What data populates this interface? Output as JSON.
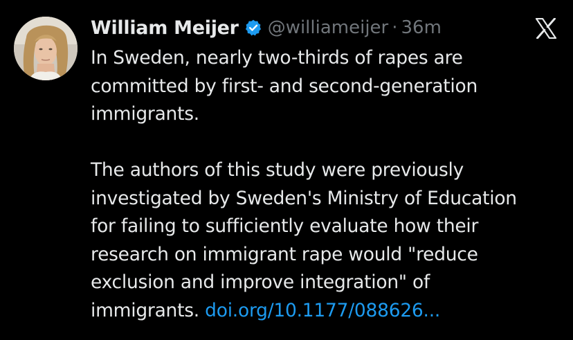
{
  "tweet": {
    "author_name": "William Meijer",
    "handle": "@williameijer",
    "separator": "·",
    "time": "36m",
    "paragraph1": [
      "In Sweden, nearly two-thirds of rapes are",
      "committed by first- and second-generation",
      "immigrants."
    ],
    "paragraph2": [
      "The authors of this study were previously",
      "investigated by Sweden's Ministry of Education",
      "for failing to sufficiently evaluate how their",
      "research on immigrant rape would \"reduce",
      "exclusion and improve integration\" of"
    ],
    "last_line_text": "immigrants. ",
    "link_text": "doi.org/10.1177/088626...",
    "icons": {
      "verified": "verified-badge-icon",
      "platform": "x-logo-icon"
    },
    "colors": {
      "background": "#000000",
      "text": "#e7e9ea",
      "muted": "#71767b",
      "link": "#1d9bf0",
      "verified": "#1d9bf0"
    }
  }
}
